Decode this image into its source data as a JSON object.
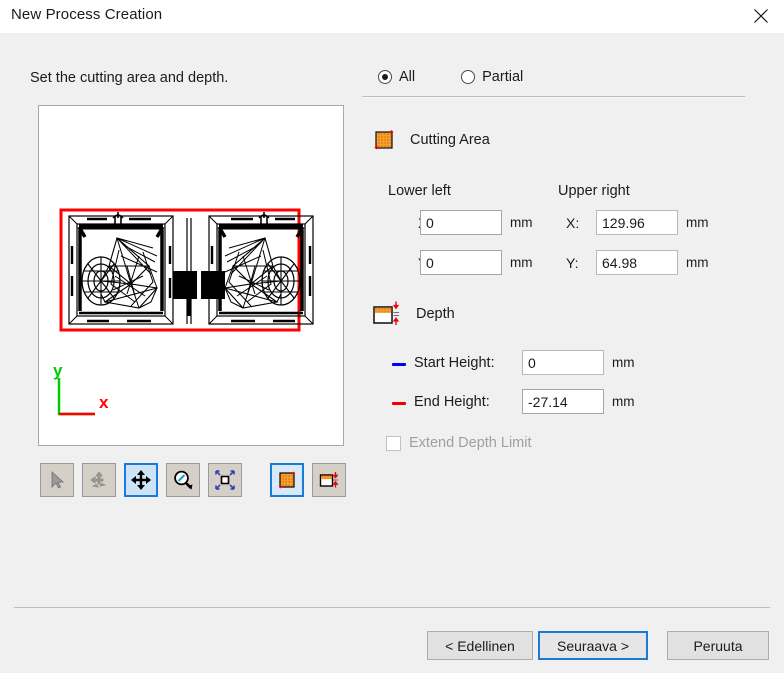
{
  "window": {
    "title": "New Process Creation",
    "close_icon": "close-icon"
  },
  "instruction": "Set the cutting area and depth.",
  "preview": {
    "axis_x_label": "x",
    "axis_y_label": "y",
    "axis_x_color": "#ff0000",
    "axis_y_color": "#00cc00",
    "bounding_box_color": "#ff0000",
    "model_color": "#000000",
    "background": "#ffffff"
  },
  "toolbar": {
    "buttons": [
      {
        "name": "select-tool",
        "icon": "cursor-arrow-icon",
        "state": "disabled"
      },
      {
        "name": "rotate-tool",
        "icon": "rotate-icon",
        "state": "disabled"
      },
      {
        "name": "pan-tool",
        "icon": "move-arrows-icon",
        "state": "selected"
      },
      {
        "name": "zoom-tool",
        "icon": "magnifier-icon",
        "state": "normal"
      },
      {
        "name": "fit-view-tool",
        "icon": "fit-to-screen-icon",
        "state": "normal"
      },
      {
        "name": "cutting-area-tool",
        "icon": "cutting-area-icon",
        "state": "selected"
      },
      {
        "name": "depth-tool",
        "icon": "depth-icon",
        "state": "normal"
      }
    ]
  },
  "scope": {
    "options": [
      {
        "label": "All",
        "checked": true
      },
      {
        "label": "Partial",
        "checked": false
      }
    ]
  },
  "cutting_area": {
    "title": "Cutting Area",
    "icon": "cutting-area-icon",
    "lower_left": {
      "group_label": "Lower left",
      "x_label": "X:",
      "x_value": "0",
      "x_unit": "mm",
      "y_label": "Y:",
      "y_value": "0",
      "y_unit": "mm"
    },
    "upper_right": {
      "group_label": "Upper right",
      "x_label": "X:",
      "x_value": "129.96",
      "x_unit": "mm",
      "y_label": "Y:",
      "y_value": "64.98",
      "y_unit": "mm"
    }
  },
  "depth": {
    "title": "Depth",
    "icon": "depth-icon",
    "start_height": {
      "label": "Start Height:",
      "value": "0",
      "unit": "mm",
      "marker_color": "#0000ee"
    },
    "end_height": {
      "label": "End Height:",
      "value": "-27.14",
      "unit": "mm",
      "marker_color": "#ee0000"
    },
    "extend_depth_limit": {
      "label": "Extend Depth Limit",
      "checked": false,
      "enabled": false
    }
  },
  "footer": {
    "back_label": "< Edellinen",
    "next_label": "Seuraava >",
    "cancel_label": "Peruuta"
  },
  "colors": {
    "accent": "#1a7ad9",
    "orange": "#f29020",
    "dialog_bg": "#f0f0f0",
    "titlebar_bg": "#ffffff"
  }
}
